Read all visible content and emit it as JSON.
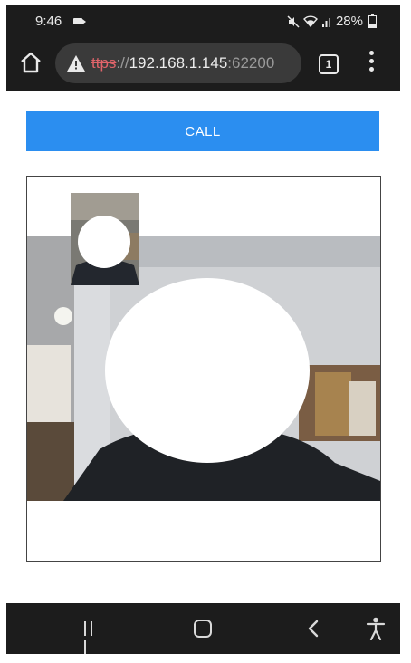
{
  "status_bar": {
    "time": "9:46",
    "battery": "28%",
    "icons": [
      "video-camera-icon",
      "mute-icon",
      "wifi-icon",
      "signal-icon",
      "battery-icon"
    ]
  },
  "browser": {
    "url_scheme": "ttps",
    "url_separator": "://",
    "url_host": "192.168.1.145",
    "url_port": ":62200",
    "tab_count": "1",
    "icons": [
      "home-icon",
      "warning-icon",
      "tabs-icon",
      "more-vert-icon"
    ]
  },
  "page": {
    "call_label": "CALL",
    "accent_color": "#2b8ef0"
  },
  "nav": {
    "icons": [
      "recent-apps-icon",
      "home-icon",
      "back-icon",
      "accessibility-icon"
    ]
  }
}
